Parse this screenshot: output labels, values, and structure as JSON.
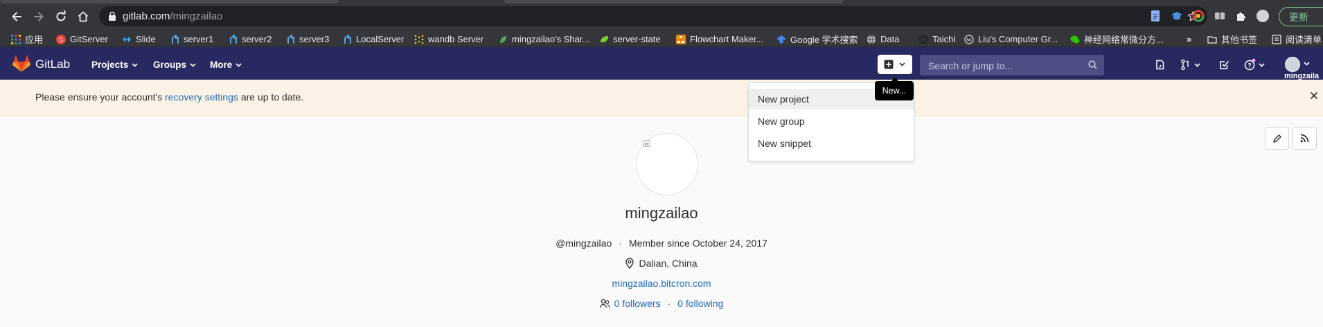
{
  "browser": {
    "url_host": "gitlab.com",
    "url_path": "/mingzailao",
    "update_label": "更新"
  },
  "bookmarks": [
    {
      "label": "应用",
      "icon": "apps-grid-icon",
      "color": "#4285f4"
    },
    {
      "label": "GitServer",
      "icon": "gitserver-icon",
      "color": "#ea4335"
    },
    {
      "label": "Slide",
      "icon": "slide-icon",
      "color": "#4aa3df"
    },
    {
      "label": "server1",
      "icon": "server-icon",
      "color": "#5ba3e0"
    },
    {
      "label": "server2",
      "icon": "server-icon",
      "color": "#5ba3e0"
    },
    {
      "label": "server3",
      "icon": "server-icon",
      "color": "#5ba3e0"
    },
    {
      "label": "LocalServer",
      "icon": "server-icon",
      "color": "#5ba3e0"
    },
    {
      "label": "wandb Server",
      "icon": "wandb-icon",
      "color": "#f4c430"
    },
    {
      "label": "mingzailao's Shar...",
      "icon": "leaf-icon",
      "color": "#4caf50"
    },
    {
      "label": "server-state",
      "icon": "leaf-icon",
      "color": "#7ed321"
    },
    {
      "label": "Flowchart Maker...",
      "icon": "flowchart-icon",
      "color": "#f08705"
    },
    {
      "label": "Google 学术搜索",
      "icon": "scholar-icon",
      "color": "#4285f4"
    },
    {
      "label": "Data",
      "icon": "globe-icon",
      "color": "#bdc1c6"
    },
    {
      "label": "Taichi",
      "icon": "github-icon",
      "color": "#24292e"
    },
    {
      "label": "Liu's Computer Gr...",
      "icon": "wordpress-icon",
      "color": "#bdc1c6"
    },
    {
      "label": "神经网络常微分方...",
      "icon": "wechat-icon",
      "color": "#2dc100"
    }
  ],
  "bookmarks_more": "»",
  "bookmarks_other": "其他书签",
  "reading_list": "阅读清单",
  "gitlab": {
    "brand": "GitLab",
    "nav": [
      "Projects",
      "Groups",
      "More"
    ],
    "search_placeholder": "Search or jump to...",
    "user_truncated": "mingzaila"
  },
  "tooltip": "New...",
  "dropdown": [
    "New project",
    "New group",
    "New snippet"
  ],
  "banner": {
    "prefix": "Please ensure your account's ",
    "link": "recovery settings",
    "suffix": " are up to date."
  },
  "profile": {
    "name": "mingzailao",
    "handle": "@mingzailao",
    "member_since": "Member since October 24, 2017",
    "location": "Dalian, China",
    "website": "mingzailao.bitcron.com",
    "followers": "0 followers",
    "following": "0 following"
  },
  "colors": {
    "header_bg": "#292961",
    "banner_bg": "#fcf3e6",
    "link": "#1f6bb4"
  }
}
